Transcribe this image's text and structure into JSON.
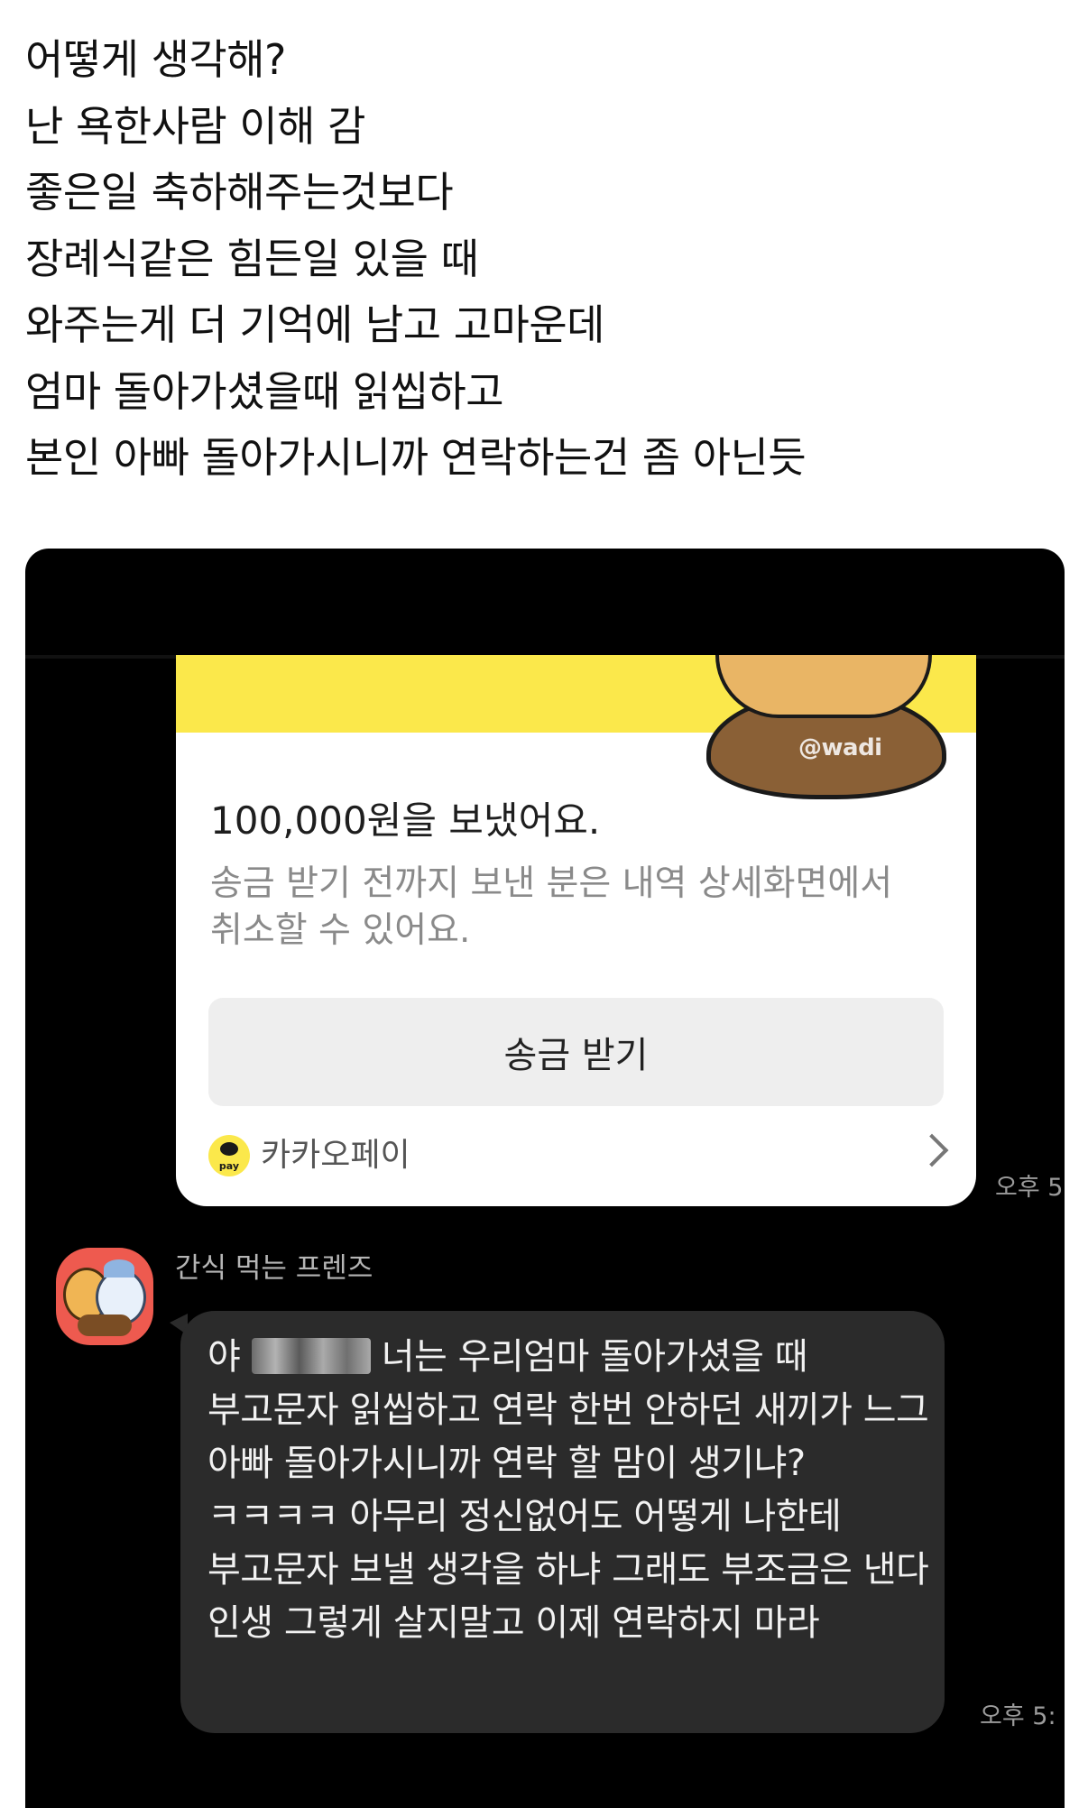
{
  "post": {
    "lines": [
      "어떻게 생각해?",
      "난 욕한사람 이해 감",
      "좋은일 축하해주는것보다",
      "장례식같은 힘든일 있을 때",
      "와주는게 더 기억에 남고 고마운데",
      "엄마 돌아가셨을때 읽씹하고",
      "본인 아빠 돌아가시니까 연락하는건 좀 아닌듯"
    ]
  },
  "payment_card": {
    "watermark": "@wadi",
    "amount_text": "100,000원을 보냈어요.",
    "description": "송금 받기 전까지 보낸 분은 내역 상세화면에서 취소할 수 있어요.",
    "button_label": "송금 받기",
    "logo_text": "pay",
    "brand": "카카오페이",
    "time": "오후 5"
  },
  "message": {
    "sender": "간식 먹는 프렌즈",
    "prefix": "야",
    "text": "너는 우리엄마 돌아가셨을 때 부고문자 읽씹하고 연락 한번 안하던 새끼가 느그 아빠 돌아가시니까 연락 할 맘이 생기냐? ㅋㅋㅋㅋ 아무리 정신없어도 어떻게 나한테 부고문자 보낼 생각을 하냐 그래도 부조금은 낸다 인생 그렇게 살지말고 이제 연락하지 마라",
    "time": "오후 5:"
  }
}
